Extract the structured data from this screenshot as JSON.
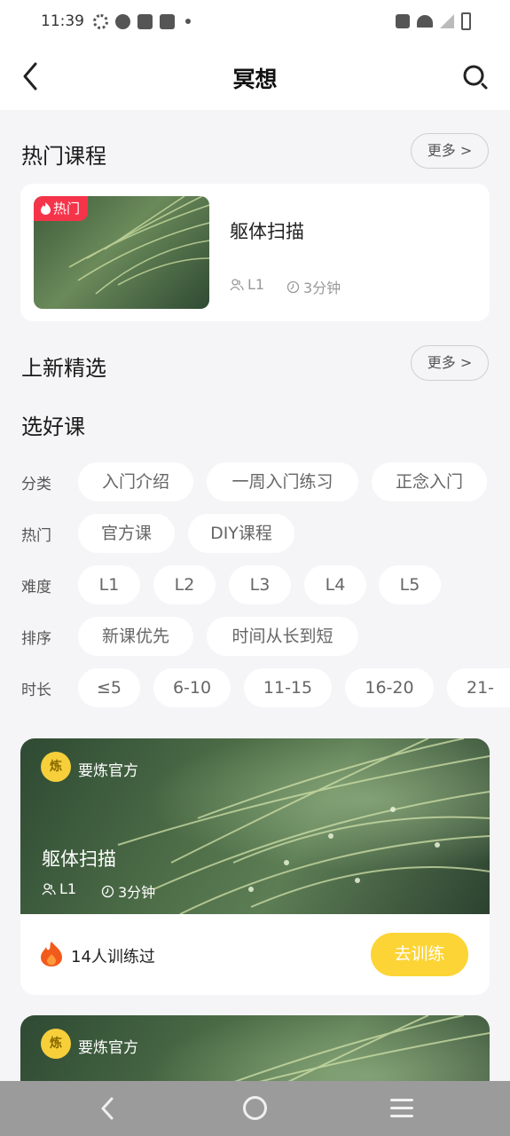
{
  "status_bar": {
    "time": "11:39"
  },
  "header": {
    "title": "冥想"
  },
  "hot_section": {
    "title": "热门课程",
    "more_label": "更多 >",
    "course": {
      "tag": "热门",
      "name": "躯体扫描",
      "level": "L1",
      "duration": "3分钟"
    }
  },
  "new_section": {
    "title": "上新精选",
    "more_label": "更多 >"
  },
  "picker": {
    "title": "选好课",
    "filters": [
      {
        "label": "分类",
        "options": [
          "入门介绍",
          "一周入门练习",
          "正念入门"
        ]
      },
      {
        "label": "热门",
        "options": [
          "官方课",
          "DIY课程"
        ]
      },
      {
        "label": "难度",
        "options": [
          "L1",
          "L2",
          "L3",
          "L4",
          "L5"
        ]
      },
      {
        "label": "排序",
        "options": [
          "新课优先",
          "时间从长到短"
        ]
      },
      {
        "label": "时长",
        "options": [
          "≤5",
          "6-10",
          "11-15",
          "16-20",
          "21-"
        ]
      }
    ]
  },
  "course_cards": [
    {
      "author": "要炼官方",
      "avatar_text": "炼",
      "name": "躯体扫描",
      "level": "L1",
      "duration": "3分钟",
      "trained": "14人训练过",
      "button": "去训练"
    },
    {
      "author": "要炼官方",
      "avatar_text": "炼"
    }
  ],
  "colors": {
    "accent_yellow": "#fcd435",
    "hot_red": "#f5344a",
    "flame_orange": "#f25a1c"
  },
  "icons": {
    "back": "chevron-left-icon",
    "search": "search-icon",
    "users": "users-icon",
    "clock": "clock-icon",
    "flame": "flame-icon"
  }
}
